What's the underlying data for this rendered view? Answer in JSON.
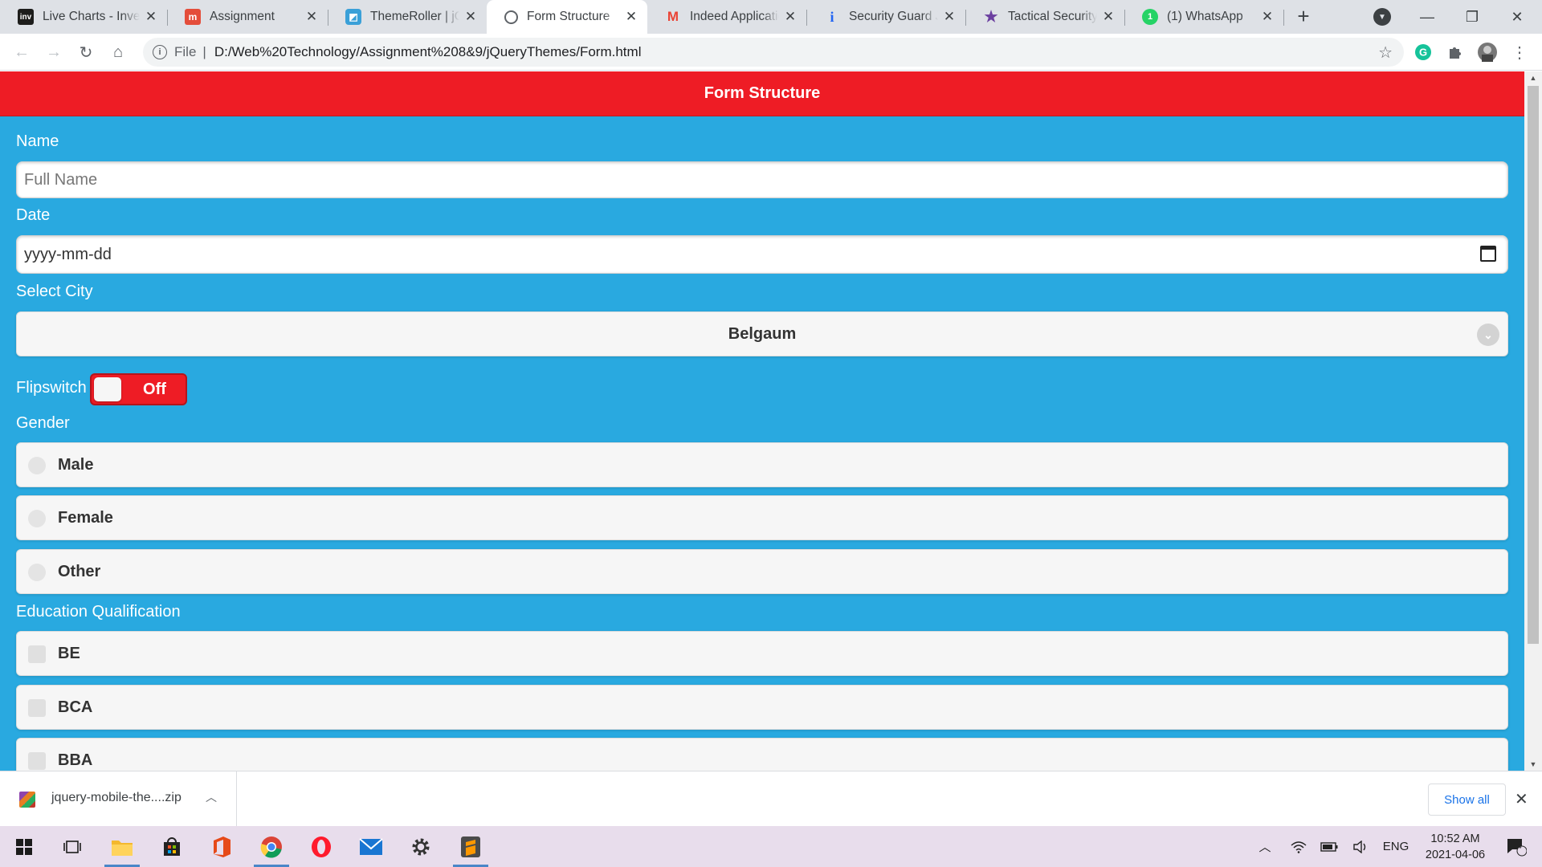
{
  "browser": {
    "tabs": [
      {
        "label": "Live Charts - Investing.com",
        "icon": "investing-icon",
        "active": false
      },
      {
        "label": "Assignment",
        "icon": "moodle-icon",
        "active": false
      },
      {
        "label": "ThemeRoller | jQuery Mobile",
        "icon": "themeroller-icon",
        "active": false
      },
      {
        "label": "Form Structure",
        "icon": "globe-icon",
        "active": true
      },
      {
        "label": "Indeed Application",
        "icon": "gmail-icon",
        "active": false
      },
      {
        "label": "Security Guard Jobs",
        "icon": "indeed-icon",
        "active": false
      },
      {
        "label": "Tactical Security Guard",
        "icon": "star-icon",
        "active": false
      },
      {
        "label": "(1) WhatsApp",
        "icon": "whatsapp-icon",
        "active": false
      }
    ],
    "address": {
      "scheme": "File",
      "url": "D:/Web%20Technology/Assignment%208&9/jQueryThemes/Form.html"
    }
  },
  "page": {
    "header_title": "Form Structure",
    "name_label": "Name",
    "name_placeholder": "Full Name",
    "date_label": "Date",
    "date_placeholder": "yyyy-mm-dd",
    "city_label": "Select City",
    "city_selected": "Belgaum",
    "flipswitch_label": "Flipswitch",
    "flipswitch_state": "Off",
    "gender_label": "Gender",
    "gender_options": [
      "Male",
      "Female",
      "Other"
    ],
    "education_label": "Education Qualification",
    "education_options": [
      "BE",
      "BCA",
      "BBA"
    ]
  },
  "download_shelf": {
    "file_name": "jquery-mobile-the....zip",
    "show_all_label": "Show all"
  },
  "taskbar": {
    "language": "ENG",
    "time": "10:52 AM",
    "date": "2021-04-06",
    "notification_count": "4"
  },
  "colors": {
    "header_red": "#ee1c25",
    "page_blue": "#29a9e0",
    "row_gray": "#f6f6f6"
  }
}
